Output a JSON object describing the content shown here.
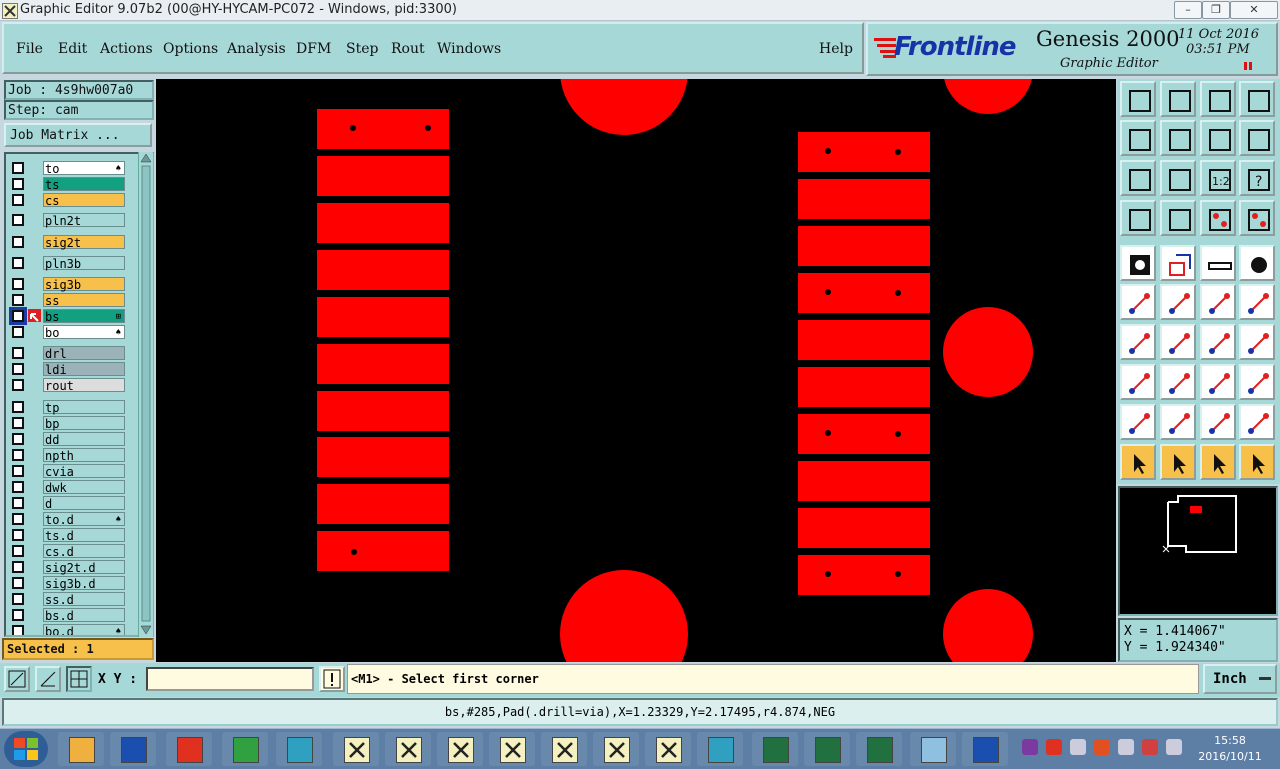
{
  "window": {
    "title": "Graphic Editor 9.07b2 (00@HY-HYCAM-PC072 - Windows, pid:3300)",
    "controls": [
      "–",
      "❐",
      "✕"
    ]
  },
  "menubar": {
    "items": [
      {
        "label": "File"
      },
      {
        "label": "Edit"
      },
      {
        "label": "Actions"
      },
      {
        "label": "Options"
      },
      {
        "label": "Analysis"
      },
      {
        "label": "DFM"
      },
      {
        "label": "Step"
      },
      {
        "label": "Rout"
      },
      {
        "label": "Windows"
      }
    ],
    "help": "Help"
  },
  "logo": {
    "brand": "Frontline",
    "product": "Genesis 2000",
    "subtitle": "Graphic Editor",
    "date": "11 Oct 2016",
    "time": "03:51 PM"
  },
  "job": {
    "job_line": "Job : 4s9hw007a0",
    "step_line": "Step: cam",
    "matrix_button": "Job Matrix ..."
  },
  "layers": [
    {
      "name": "to",
      "color": "#ffffff",
      "flag": "♠"
    },
    {
      "name": "ts",
      "color": "#13a080",
      "flag": ""
    },
    {
      "name": "cs",
      "color": "#f6c04b",
      "flag": ""
    },
    {
      "name": "pln2t",
      "color": "#a6d8d8",
      "flag": ""
    },
    {
      "name": "sig2t",
      "color": "#f6c04b",
      "flag": ""
    },
    {
      "name": "pln3b",
      "color": "#a6d8d8",
      "flag": ""
    },
    {
      "name": "sig3b",
      "color": "#f6c04b",
      "flag": ""
    },
    {
      "name": "ss",
      "color": "#f6c04b",
      "flag": ""
    },
    {
      "name": "bs",
      "color": "#13a080",
      "flag": "⊞",
      "active": true
    },
    {
      "name": "bo",
      "color": "#ffffff",
      "flag": "♠"
    },
    {
      "name": "drl",
      "color": "#9bb3b8",
      "flag": ""
    },
    {
      "name": "ldi",
      "color": "#9bb3b8",
      "flag": ""
    },
    {
      "name": "rout",
      "color": "#dddddd",
      "flag": ""
    },
    {
      "name": "tp",
      "color": "#a6d8d8",
      "flag": ""
    },
    {
      "name": "bp",
      "color": "#a6d8d8",
      "flag": ""
    },
    {
      "name": "dd",
      "color": "#a6d8d8",
      "flag": ""
    },
    {
      "name": "npth",
      "color": "#a6d8d8",
      "flag": ""
    },
    {
      "name": "cvia",
      "color": "#a6d8d8",
      "flag": ""
    },
    {
      "name": "dwk",
      "color": "#a6d8d8",
      "flag": ""
    },
    {
      "name": "d",
      "color": "#a6d8d8",
      "flag": ""
    },
    {
      "name": "to.d",
      "color": "#a6d8d8",
      "flag": "♠"
    },
    {
      "name": "ts.d",
      "color": "#a6d8d8",
      "flag": ""
    },
    {
      "name": "cs.d",
      "color": "#a6d8d8",
      "flag": ""
    },
    {
      "name": "sig2t.d",
      "color": "#a6d8d8",
      "flag": ""
    },
    {
      "name": "sig3b.d",
      "color": "#a6d8d8",
      "flag": ""
    },
    {
      "name": "ss.d",
      "color": "#a6d8d8",
      "flag": ""
    },
    {
      "name": "bs.d",
      "color": "#a6d8d8",
      "flag": ""
    },
    {
      "name": "bo.d",
      "color": "#a6d8d8",
      "flag": "♠"
    }
  ],
  "selected": "Selected : 1",
  "coords": {
    "x": "X = 1.414067\"",
    "y": "Y = 1.924340\""
  },
  "bottom": {
    "xy_label": "X Y :",
    "xy_value": "",
    "prompt": "<M1> - Select first corner",
    "units": "Inch"
  },
  "status": "bs,#285,Pad(.drill=via),X=1.23329,Y=2.17495,r4.874,NEG",
  "taskbar": {
    "time": "15:58",
    "date": "2016/10/11"
  },
  "colors": {
    "panel": "#a6d8d8",
    "copper": "#ff0000",
    "canvas": "#000000",
    "accent": "#f6c04b"
  }
}
